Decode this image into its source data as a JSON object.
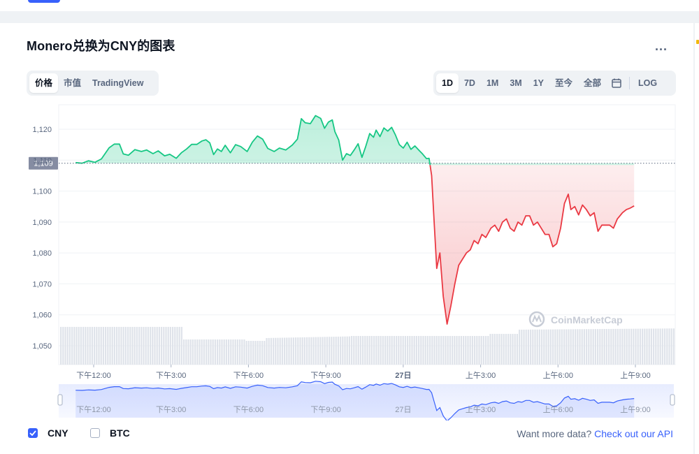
{
  "header": {
    "title": "Monero兑换为CNY的图表",
    "more_label": "..."
  },
  "view_tabs": [
    {
      "label": "价格",
      "active": true
    },
    {
      "label": "市值",
      "active": false
    },
    {
      "label": "TradingView",
      "active": false
    }
  ],
  "range_tabs": [
    {
      "label": "1D",
      "active": true
    },
    {
      "label": "7D",
      "active": false
    },
    {
      "label": "1M",
      "active": false
    },
    {
      "label": "3M",
      "active": false
    },
    {
      "label": "1Y",
      "active": false
    },
    {
      "label": "至今",
      "active": false
    },
    {
      "label": "全部",
      "active": false
    }
  ],
  "log_label": "LOG",
  "icons": {
    "calendar": "calendar-icon",
    "check": "check-icon",
    "watermark": "coinmarketcap-logo-icon"
  },
  "colors": {
    "up": "#16c784",
    "down": "#ea3943",
    "accent": "#3861fb",
    "volume": "#d9dde5"
  },
  "watermark_text": "CoinMarketCap",
  "chart_data": {
    "type": "line",
    "y_ticks": [
      1050,
      1060,
      1070,
      1080,
      1090,
      1100,
      1110,
      1120
    ],
    "y_tick_labels": [
      "1,050",
      "1,060",
      "1,070",
      "1,080",
      "1,090",
      "1,100",
      "1,110",
      "1,120"
    ],
    "ylim": [
      1045,
      1128
    ],
    "reference_value": 1109,
    "reference_label": "1,109",
    "x_ticks": [
      {
        "t": 2,
        "label": "下午12:00"
      },
      {
        "t": 5,
        "label": "下午3:00"
      },
      {
        "t": 8,
        "label": "下午6:00"
      },
      {
        "t": 11,
        "label": "下午9:00"
      },
      {
        "t": 14,
        "label": "27日"
      },
      {
        "t": 17,
        "label": "上午3:00"
      },
      {
        "t": 20,
        "label": "上午6:00"
      },
      {
        "t": 23,
        "label": "上午9:00"
      }
    ],
    "xlim": [
      1.3,
      24.6
    ],
    "series": [
      {
        "values": [
          [
            1.3,
            1109.2
          ],
          [
            1.55,
            1109.0
          ],
          [
            1.8,
            1109.8
          ],
          [
            2.05,
            1109.3
          ],
          [
            2.3,
            1110.4
          ],
          [
            2.6,
            1114
          ],
          [
            2.8,
            1115.2
          ],
          [
            3.0,
            1115.2
          ],
          [
            3.15,
            1112
          ],
          [
            3.35,
            1111.6
          ],
          [
            3.6,
            1113.4
          ],
          [
            3.85,
            1112.8
          ],
          [
            4.05,
            1113.3
          ],
          [
            4.3,
            1112.1
          ],
          [
            4.5,
            1113
          ],
          [
            4.75,
            1111.4
          ],
          [
            4.95,
            1111.9
          ],
          [
            5.2,
            1110.6
          ],
          [
            5.4,
            1112.4
          ],
          [
            5.6,
            1113.6
          ],
          [
            5.8,
            1115.1
          ],
          [
            6.0,
            1115.1
          ],
          [
            6.2,
            1116.2
          ],
          [
            6.35,
            1116.6
          ],
          [
            6.5,
            1115.6
          ],
          [
            6.65,
            1111.8
          ],
          [
            6.8,
            1113.6
          ],
          [
            6.95,
            1112.8
          ],
          [
            7.1,
            1114.8
          ],
          [
            7.3,
            1112.4
          ],
          [
            7.5,
            1115.0
          ],
          [
            7.7,
            1114.4
          ],
          [
            7.95,
            1112.8
          ],
          [
            8.15,
            1115.8
          ],
          [
            8.35,
            1117.8
          ],
          [
            8.55,
            1116.8
          ],
          [
            8.75,
            1113.8
          ],
          [
            9.0,
            1112.8
          ],
          [
            9.2,
            1113.9
          ],
          [
            9.45,
            1113.3
          ],
          [
            9.7,
            1114.9
          ],
          [
            9.9,
            1116.8
          ],
          [
            10.05,
            1123.4
          ],
          [
            10.2,
            1122.1
          ],
          [
            10.4,
            1121.8
          ],
          [
            10.6,
            1124.4
          ],
          [
            10.8,
            1123.5
          ],
          [
            10.95,
            1120.3
          ],
          [
            11.1,
            1122.3
          ],
          [
            11.25,
            1123.0
          ],
          [
            11.35,
            1119.2
          ],
          [
            11.5,
            1116.5
          ],
          [
            11.65,
            1110
          ],
          [
            11.8,
            1112.1
          ],
          [
            11.95,
            1111.5
          ],
          [
            12.1,
            1113.3
          ],
          [
            12.25,
            1115.3
          ],
          [
            12.4,
            1110.9
          ],
          [
            12.55,
            1114.5
          ],
          [
            12.7,
            1118.6
          ],
          [
            12.85,
            1117.4
          ],
          [
            12.95,
            1119.7
          ],
          [
            13.1,
            1117.6
          ],
          [
            13.25,
            1120.4
          ],
          [
            13.4,
            1119.4
          ],
          [
            13.55,
            1120.6
          ],
          [
            13.7,
            1118.1
          ],
          [
            13.85,
            1115.0
          ],
          [
            14.0,
            1113.9
          ],
          [
            14.15,
            1115.8
          ],
          [
            14.3,
            1113.5
          ],
          [
            14.45,
            1114.6
          ],
          [
            14.6,
            1113.3
          ],
          [
            14.75,
            1112.0
          ],
          [
            14.9,
            1110.5
          ],
          [
            15.0,
            1110.6
          ],
          [
            15.1,
            1105
          ],
          [
            15.2,
            1090
          ],
          [
            15.3,
            1075
          ],
          [
            15.42,
            1080
          ],
          [
            15.55,
            1066
          ],
          [
            15.7,
            1057
          ],
          [
            15.85,
            1063
          ],
          [
            16.0,
            1070
          ],
          [
            16.15,
            1076
          ],
          [
            16.3,
            1078
          ],
          [
            16.45,
            1080
          ],
          [
            16.6,
            1081
          ],
          [
            16.75,
            1084
          ],
          [
            16.9,
            1083
          ],
          [
            17.05,
            1086
          ],
          [
            17.2,
            1085
          ],
          [
            17.4,
            1088
          ],
          [
            17.55,
            1089
          ],
          [
            17.7,
            1087
          ],
          [
            17.85,
            1090
          ],
          [
            18.0,
            1091
          ],
          [
            18.15,
            1088
          ],
          [
            18.3,
            1087
          ],
          [
            18.45,
            1090
          ],
          [
            18.6,
            1089
          ],
          [
            18.75,
            1092
          ],
          [
            18.9,
            1092
          ],
          [
            19.05,
            1089
          ],
          [
            19.2,
            1090
          ],
          [
            19.35,
            1088
          ],
          [
            19.5,
            1086
          ],
          [
            19.65,
            1086
          ],
          [
            19.8,
            1082
          ],
          [
            19.95,
            1083
          ],
          [
            20.1,
            1088
          ],
          [
            20.25,
            1096
          ],
          [
            20.4,
            1099
          ],
          [
            20.5,
            1094
          ],
          [
            20.65,
            1095
          ],
          [
            20.8,
            1092.3
          ],
          [
            20.95,
            1095.5
          ],
          [
            21.1,
            1094
          ],
          [
            21.25,
            1092
          ],
          [
            21.4,
            1093
          ],
          [
            21.55,
            1087
          ],
          [
            21.7,
            1089
          ],
          [
            21.85,
            1089
          ],
          [
            22.0,
            1089
          ],
          [
            22.15,
            1088
          ],
          [
            22.3,
            1091
          ],
          [
            22.5,
            1093
          ],
          [
            22.65,
            1094
          ],
          [
            22.8,
            1094.5
          ],
          [
            22.95,
            1095.2
          ]
        ]
      }
    ]
  },
  "legend": {
    "items": [
      {
        "label": "CNY",
        "checked": true
      },
      {
        "label": "BTC",
        "checked": false
      }
    ]
  },
  "footer": {
    "prompt": "Want more data?",
    "link": "Check out our API"
  }
}
